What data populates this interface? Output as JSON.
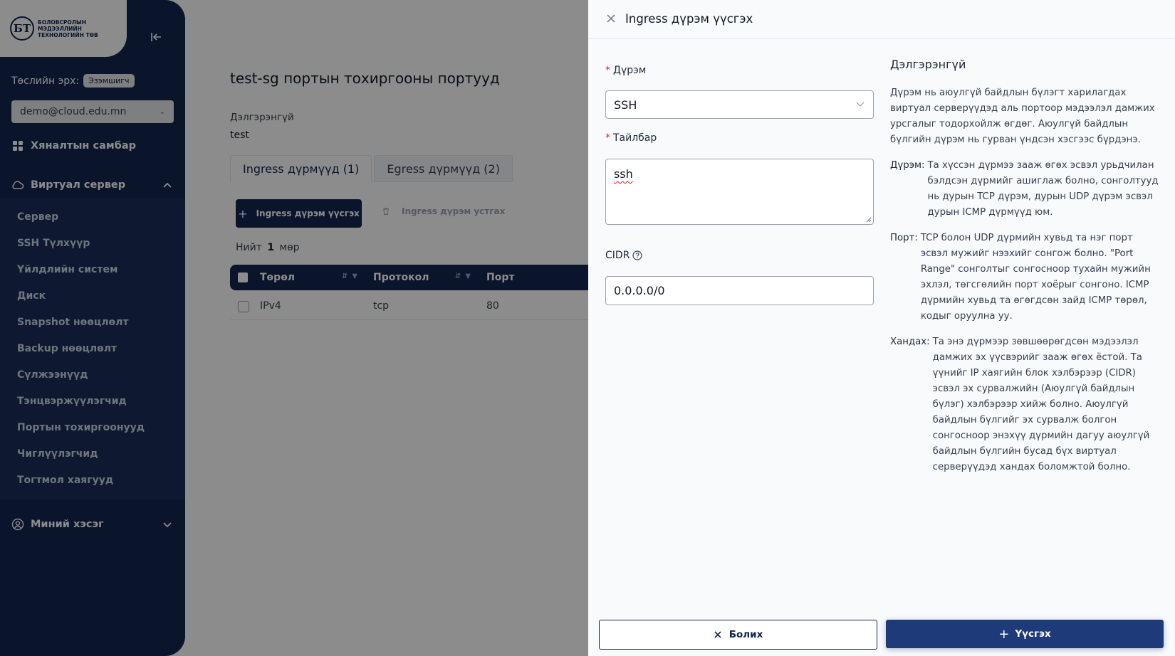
{
  "sidebar": {
    "logo_mark": "БТ",
    "logo_text": "БОЛОВСРОЛЫН МЭДЭЭЛЛИЙН ТЕХНОЛОГИЙН ТӨВ",
    "role_label": "Төслийн эрх:",
    "role_badge": "Эзэмшигч",
    "account": "demo@cloud.edu.mn",
    "dashboard": "Хяналтын самбар",
    "virtual_server": "Виртуал сервер",
    "submenu": [
      "Сервер",
      "SSH Түлхүүр",
      "Үйлдлийн систем",
      "Диск",
      "Snapshot нөөцлөлт",
      "Backup нөөцлөлт",
      "Сүлжээнүүд",
      "Тэнцвэржүүлэгчид",
      "Портын тохиргоонууд",
      "Чиглүүлэгчид",
      "Тогтмол хаягууд"
    ],
    "my_section": "Миний хэсэг"
  },
  "main": {
    "title": "test-sg портын тохиргооны портууд",
    "description_label": "Дэлгэрэнгүй",
    "description_value": "test",
    "tabs": [
      "Ingress дүрмүүд (1)",
      "Egress дүрмүүд (2)"
    ],
    "add_button": "Ingress дүрэм үүсгэх",
    "delete_button": "Ingress дүрэм устгах",
    "total_prefix": "Нийт",
    "total_count": "1",
    "total_suffix": "мөр",
    "columns": [
      "Төрөл",
      "Протокол",
      "Порт"
    ],
    "rows": [
      {
        "type": "IPv4",
        "protocol": "tcp",
        "port": "80"
      }
    ]
  },
  "drawer": {
    "title": "Ingress дүрэм үүсгэх",
    "rule_label": "Дүрэм",
    "rule_value": "SSH",
    "description_label": "Тайлбар",
    "description_value": "ssh",
    "cidr_label": "CIDR",
    "cidr_value": "0.0.0.0/0",
    "help_title": "Дэлгэрэнгүй",
    "help_intro": "Дүрэм нь аюулгүй байдлын бүлэгт харилагдах виртуал серверүүдэд аль портоор мэдээлэл дамжих урсгалыг тодорхойлж өгдөг. Аюулгүй байдлын бүлгийн дүрэм нь гурван үндсэн хэсгээс бүрдэнэ.",
    "terms": [
      {
        "key": "Дүрэм:",
        "value": "Та хүссэн дүрмээ зааж өгөх эсвэл урьдчилан бэлдсэн дүрмийг ашиглаж болно, сонголтууд нь дурын TCP дүрэм, дурын UDP дүрэм эсвэл дурын ICMP дүрмүүд юм."
      },
      {
        "key": "Порт:",
        "value": "TCP болон UDP дүрмийн хувьд та нэг порт эсвэл мужийг нээхийг сонгож болно. \"Port Range\" сонголтыг сонгосноор тухайн мужийн эхлэл, төгсгөлийн порт хоёрыг сонгоно. ICMP дүрмийн хувьд та өгөгдсөн зайд ICMP төрөл, кодыг оруулна уу."
      },
      {
        "key": "Хандах:",
        "value": "Та энэ дүрмээр зөвшөөрөгдсөн мэдээлэл дамжих эх үүсвэрийг зааж өгөх ёстой. Та үүнийг IP хаягийн блок хэлбэрээр (CIDR) эсвэл эх сурвалжийн (Аюулгүй байдлын бүлэг) хэлбэрээр хийж болно. Аюулгүй байдлын бүлгийг эх сурвалж болгон сонгосноор энэхүү дүрмийн дагуу аюулгүй байдлын бүлгийн бусад бүх виртуал серверүүдэд хандах боломжтой болно."
      }
    ],
    "cancel_button": "Болих",
    "create_button": "Үүсгэх"
  }
}
